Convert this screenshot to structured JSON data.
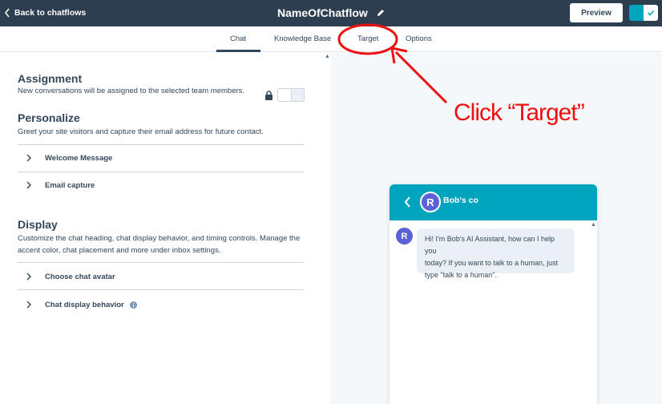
{
  "topbar": {
    "back_label": "Back to chatflows",
    "title": "NameOfChatflow",
    "preview_label": "Preview"
  },
  "tabs": [
    {
      "label": "Chat",
      "active": true
    },
    {
      "label": "Knowledge Base",
      "active": false
    },
    {
      "label": "Target",
      "active": false
    },
    {
      "label": "Options",
      "active": false
    }
  ],
  "assignment": {
    "title": "Assignment",
    "description": "New conversations will be assigned to the selected team members."
  },
  "personalize": {
    "title": "Personalize",
    "description": "Greet your site visitors and capture their email address for future contact.",
    "items": [
      "Welcome Message",
      "Email capture"
    ]
  },
  "display": {
    "title": "Display",
    "description_line1": "Customize the chat heading, chat display behavior, and timing controls. Manage the",
    "description_line2": "accent color, chat placement and more under inbox settings.",
    "items": [
      "Choose chat avatar",
      "Chat display behavior"
    ]
  },
  "chat_preview": {
    "avatar_letter": "R",
    "company_name": "Bob's co",
    "message_line1": "Hi! I'm Bob's AI Assistant, how can I help you",
    "message_line2": "today? If you want to talk to a human, just",
    "message_line3": "type \"talk to a human\"."
  },
  "annotation": {
    "text": "Click “Target”"
  },
  "colors": {
    "topbar": "#2d3e50",
    "accent": "#00a4bd",
    "avatar": "#5c62d6",
    "annotation": "#ee1111"
  },
  "icons": [
    "chevron-left-icon",
    "pencil-icon",
    "checkmark-icon",
    "lock-icon",
    "chevron-right-icon",
    "info-icon"
  ]
}
